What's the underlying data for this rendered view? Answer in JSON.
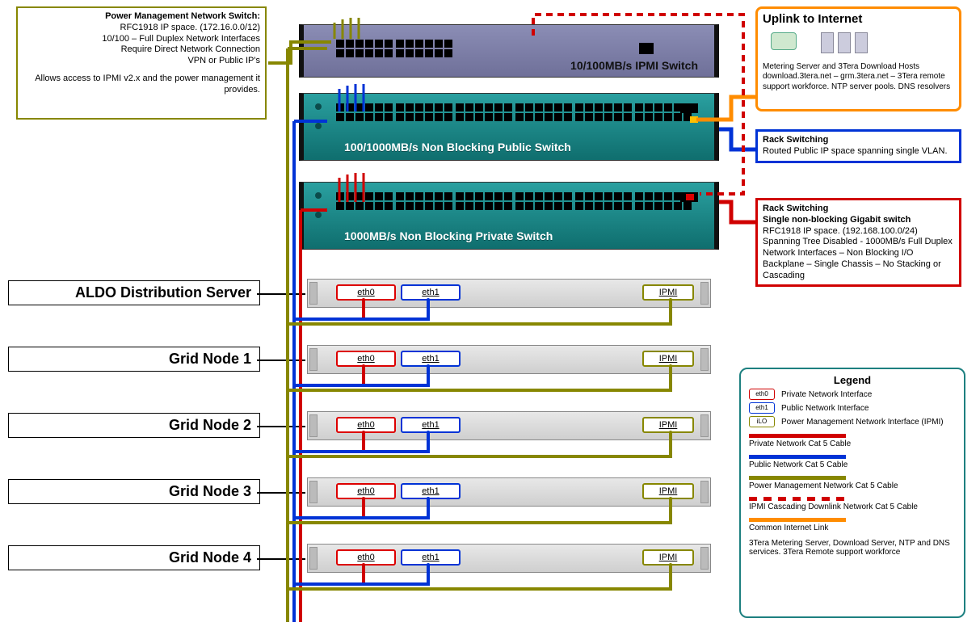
{
  "annotations": {
    "pmn": {
      "title": "Power Management Network Switch:",
      "l1": "RFC1918 IP space. (172.16.0.0/12)",
      "l2": "10/100 – Full Duplex Network Interfaces",
      "l3": "Require Direct Network Connection",
      "l4": "VPN or Public IP's",
      "l5": "Allows access to IPMI v2.x and the power management it provides."
    },
    "uplink": {
      "title": "Uplink to Internet",
      "body": "Metering Server and 3Tera Download Hosts download.3tera.net – grm.3tera.net – 3Tera remote support workforce. NTP server pools. DNS resolvers"
    },
    "rack_pub": {
      "title": "Rack Switching",
      "body": "Routed Public IP space spanning single VLAN."
    },
    "rack_priv": {
      "title": "Rack Switching",
      "sub": "Single non-blocking Gigabit switch",
      "body": "RFC1918 IP space. (192.168.100.0/24) Spanning Tree Disabled - 1000MB/s Full Duplex Network Interfaces – Non Blocking I/O Backplane – Single Chassis – No Stacking or Cascading"
    }
  },
  "switches": {
    "ipmi": {
      "label": "10/100MB/s IPMI Switch",
      "bg1": "#8b8db5",
      "bg2": "#6f7099"
    },
    "public": {
      "label": "100/1000MB/s Non Blocking Public Switch",
      "bg1": "#1f8e8e",
      "bg2": "#0f6e6e"
    },
    "private": {
      "label": "1000MB/s Non Blocking Private Switch",
      "bg1": "#1f8e8e",
      "bg2": "#0f6e6e"
    }
  },
  "servers": [
    {
      "label": "ALDO Distribution Server",
      "eth0": "eth0",
      "eth1": "eth1",
      "ipmi": "IPMI"
    },
    {
      "label": "Grid Node 1",
      "eth0": "eth0",
      "eth1": "eth1",
      "ipmi": "IPMI"
    },
    {
      "label": "Grid Node 2",
      "eth0": "eth0",
      "eth1": "eth1",
      "ipmi": "IPMI"
    },
    {
      "label": "Grid Node 3",
      "eth0": "eth0",
      "eth1": "eth1",
      "ipmi": "IPMI"
    },
    {
      "label": "Grid Node 4",
      "eth0": "eth0",
      "eth1": "eth1",
      "ipmi": "IPMI"
    }
  ],
  "legend": {
    "title": "Legend",
    "iface": {
      "eth0": {
        "chip": "eth0",
        "text": "Private Network Interface",
        "color": "#d00000"
      },
      "eth1": {
        "chip": "eth1",
        "text": "Public Network Interface",
        "color": "#0033d6"
      },
      "ilo": {
        "chip": "iLO",
        "text": "Power Management Network Interface (IPMI)",
        "color": "#878700"
      }
    },
    "cables": [
      {
        "text": "Private Network Cat 5 Cable",
        "color": "#d00000",
        "dash": false
      },
      {
        "text": "Public Network Cat 5 Cable",
        "color": "#0033d6",
        "dash": false
      },
      {
        "text": "Power Management Network Cat 5 Cable",
        "color": "#878700",
        "dash": false
      },
      {
        "text": "IPMI Cascading Downlink Network Cat 5 Cable",
        "color": "#d00000",
        "dash": true
      },
      {
        "text": "Common Internet Link",
        "color": "#ff8c00",
        "dash": false
      },
      {
        "text": "3Tera Metering Server, Download Server, NTP and DNS services. 3Tera Remote support workforce",
        "color": null,
        "dash": false
      }
    ]
  },
  "colors": {
    "olive": "#878700",
    "red": "#d00000",
    "blue": "#0033d6",
    "orange": "#ff8c00",
    "teal": "#1d8080"
  },
  "chart_data": {
    "type": "network-diagram",
    "switches": [
      {
        "name": "IPMI Switch",
        "speed_mbps": [
          10,
          100
        ],
        "blocking": null,
        "ip_space": "172.16.0.0/12"
      },
      {
        "name": "Public Switch",
        "speed_mbps": [
          100,
          1000
        ],
        "blocking": "non-blocking",
        "ip_space": "Routed Public IP / single VLAN"
      },
      {
        "name": "Private Switch",
        "speed_mbps": [
          1000
        ],
        "blocking": "non-blocking",
        "ip_space": "192.168.100.0/24"
      }
    ],
    "servers": [
      "ALDO Distribution Server",
      "Grid Node 1",
      "Grid Node 2",
      "Grid Node 3",
      "Grid Node 4"
    ],
    "server_interfaces": {
      "eth0": "Private Network",
      "eth1": "Public Network",
      "IPMI": "Power Management Network"
    }
  }
}
